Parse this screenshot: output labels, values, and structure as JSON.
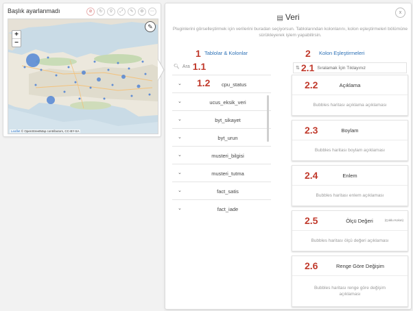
{
  "map_widget": {
    "title": "Başlık ayarlanmadı",
    "zoom_in": "+",
    "zoom_out": "−",
    "attribution_leaflet": "Leaflet",
    "attribution_osm": "© OpenStreetMap contributors, CC-BY-SA",
    "icons": [
      "filter-icon",
      "refresh-icon",
      "search-icon",
      "expand-icon",
      "edit-icon",
      "settings-icon",
      "more-icon"
    ]
  },
  "panel": {
    "title": "Veri",
    "close_label": "x",
    "description": "Pluginlerini görselleştirmek için verilerini buradan seçiyorsun. Tablolarından kolonlarını, kolon eşleştirmeleri bölümüne sürükleyerek işlem yapabilirsin.",
    "tables_section": {
      "number": "1",
      "label": "Tablolar & Kolonlar"
    },
    "mapping_section": {
      "number": "2",
      "label": "Kolon Eşleştirmeleri"
    },
    "search": {
      "placeholder": "Ara",
      "number": "1.1"
    },
    "sort": {
      "number": "2.1",
      "label": "Sıralamak İçin Tıklayınız"
    },
    "table_first_number": "1.2",
    "tables": [
      "cpu_status",
      "ucus_eksik_veri",
      "byt_sikayet",
      "byt_urun",
      "musteri_bilgisi",
      "musteri_tutma",
      "fact_satis",
      "fact_iade"
    ],
    "mappings": [
      {
        "number": "2.2",
        "label": "Açıklama",
        "tag": "",
        "hint": "Bubbles haritası açıklama açıklaması"
      },
      {
        "number": "2.3",
        "label": "Boylam",
        "tag": "",
        "hint": "Bubbles haritası boylam açıklaması"
      },
      {
        "number": "2.4",
        "label": "Enlem",
        "tag": "",
        "hint": "Bubbles haritası enlem açıklaması"
      },
      {
        "number": "2.5",
        "label": "Ölçü Değeri",
        "tag": "(Çoklu Kolon)",
        "hint": "Bubbles haritası ölçü değeri açıklaması"
      },
      {
        "number": "2.6",
        "label": "Renge Göre Değişim",
        "tag": "",
        "hint": "Bubbles haritası renge göre değişim açıklaması"
      }
    ]
  },
  "colors": {
    "accent": "#2a6fb5",
    "number_red": "#c0392b",
    "bubble": "#4a7fd4"
  }
}
